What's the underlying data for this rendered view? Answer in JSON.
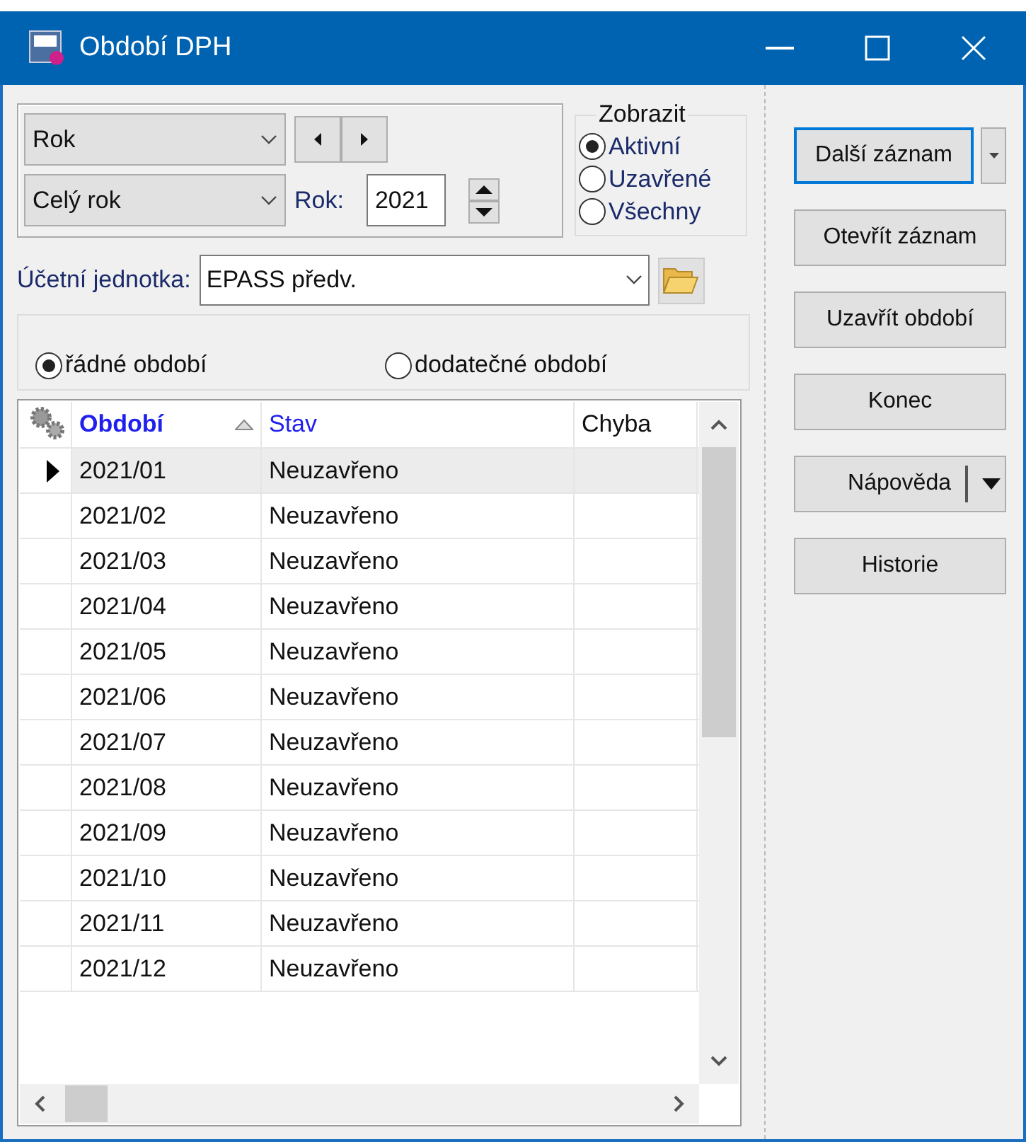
{
  "window": {
    "title": "Období DPH"
  },
  "period_type": {
    "value": "Rok"
  },
  "range": {
    "value": "Celý rok"
  },
  "year": {
    "label": "Rok:",
    "value": "2021"
  },
  "display": {
    "title": "Zobrazit",
    "options": [
      {
        "label": "Aktivní",
        "selected": true
      },
      {
        "label": "Uzavřené",
        "selected": false
      },
      {
        "label": "Všechny",
        "selected": false
      }
    ]
  },
  "unit": {
    "label": "Účetní jednotka:",
    "value": "EPASS předv."
  },
  "period_kind": [
    {
      "label": "řádné období",
      "selected": true
    },
    {
      "label": "dodatečné období",
      "selected": false
    }
  ],
  "table": {
    "columns": [
      {
        "label": "Období",
        "sorted": true
      },
      {
        "label": "Stav",
        "sorted": false
      },
      {
        "label": "Chyba",
        "sorted": false
      }
    ],
    "rows": [
      {
        "cells": [
          "2021/01",
          "Neuzavřeno"
        ],
        "selected": true
      },
      {
        "cells": [
          "2021/02",
          "Neuzavřeno"
        ],
        "selected": false
      },
      {
        "cells": [
          "2021/03",
          "Neuzavřeno"
        ],
        "selected": false
      },
      {
        "cells": [
          "2021/04",
          "Neuzavřeno"
        ],
        "selected": false
      },
      {
        "cells": [
          "2021/05",
          "Neuzavřeno"
        ],
        "selected": false
      },
      {
        "cells": [
          "2021/06",
          "Neuzavřeno"
        ],
        "selected": false
      },
      {
        "cells": [
          "2021/07",
          "Neuzavřeno"
        ],
        "selected": false
      },
      {
        "cells": [
          "2021/08",
          "Neuzavřeno"
        ],
        "selected": false
      },
      {
        "cells": [
          "2021/09",
          "Neuzavřeno"
        ],
        "selected": false
      },
      {
        "cells": [
          "2021/10",
          "Neuzavřeno"
        ],
        "selected": false
      },
      {
        "cells": [
          "2021/11",
          "Neuzavřeno"
        ],
        "selected": false
      },
      {
        "cells": [
          "2021/12",
          "Neuzavřeno"
        ],
        "selected": false
      }
    ]
  },
  "buttons": [
    {
      "label": "Další záznam",
      "kind": "split",
      "focused": true
    },
    {
      "label": "Otevřít záznam",
      "kind": "plain",
      "focused": false
    },
    {
      "label": "Uzavřít období",
      "kind": "plain",
      "focused": false
    },
    {
      "label": "Konec",
      "kind": "plain",
      "focused": false
    },
    {
      "label": "Nápověda",
      "kind": "menu",
      "focused": false
    },
    {
      "label": "Historie",
      "kind": "plain",
      "focused": false
    }
  ]
}
